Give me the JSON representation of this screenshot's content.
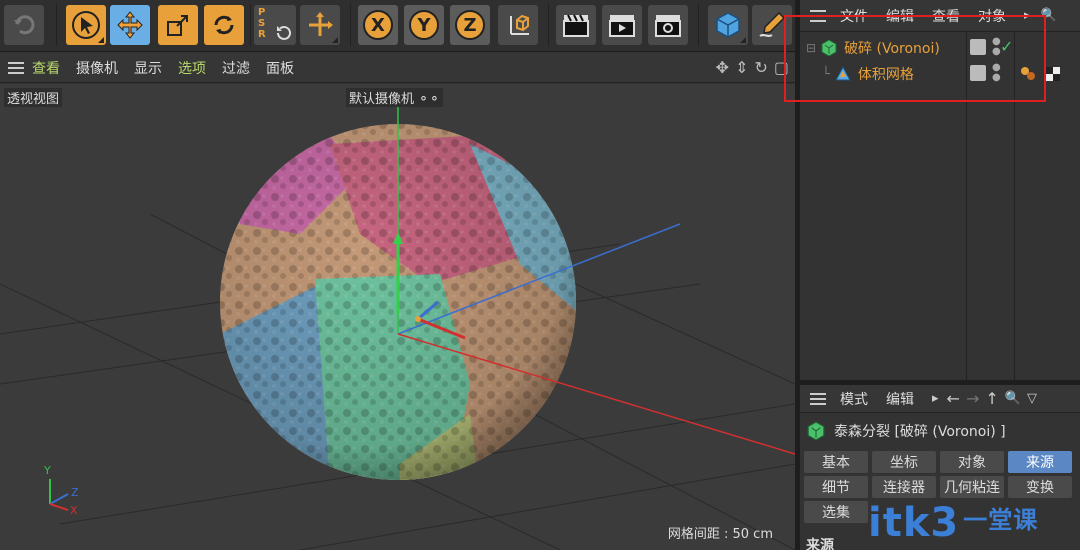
{
  "viewport_menu": {
    "items": [
      "查看",
      "摄像机",
      "显示",
      "选项",
      "过滤",
      "面板"
    ],
    "active_index": 3
  },
  "viewport": {
    "view_label": "透视视图",
    "camera_label": "默认摄像机",
    "grid_distance": "网格间距 : 50 cm",
    "axis_labels": {
      "y": "Y",
      "z": "Z",
      "x": "X"
    }
  },
  "toolbar": {
    "psr_text": "PSR",
    "axis_x": "X",
    "axis_y": "Y",
    "axis_z": "Z"
  },
  "object_manager": {
    "menu": [
      "文件",
      "编辑",
      "查看",
      "对象"
    ],
    "objects": [
      {
        "name": "破碎 (Voronoi)",
        "icon": "voronoi-fracture-icon",
        "level": 0
      },
      {
        "name": "体积网格",
        "icon": "volume-mesher-icon",
        "level": 1
      }
    ]
  },
  "attribute_manager": {
    "menu": [
      "模式",
      "编辑"
    ],
    "title": "泰森分裂 [破碎 (Voronoi) ]",
    "tabs_row1": [
      "基本",
      "坐标",
      "对象",
      "来源"
    ],
    "tabs_row2": [
      "细节",
      "连接器",
      "几何粘连",
      "变换"
    ],
    "tabs_row3": [
      "选集"
    ],
    "active_tab": "来源",
    "section_label": "来源"
  },
  "watermark": {
    "main": "itk3",
    "sub": "一堂课"
  },
  "colors": {
    "accent_orange": "#e8a13a",
    "active_tab": "#5b87c4",
    "highlight_box": "#e02020",
    "menu_active": "#b8d86b"
  }
}
